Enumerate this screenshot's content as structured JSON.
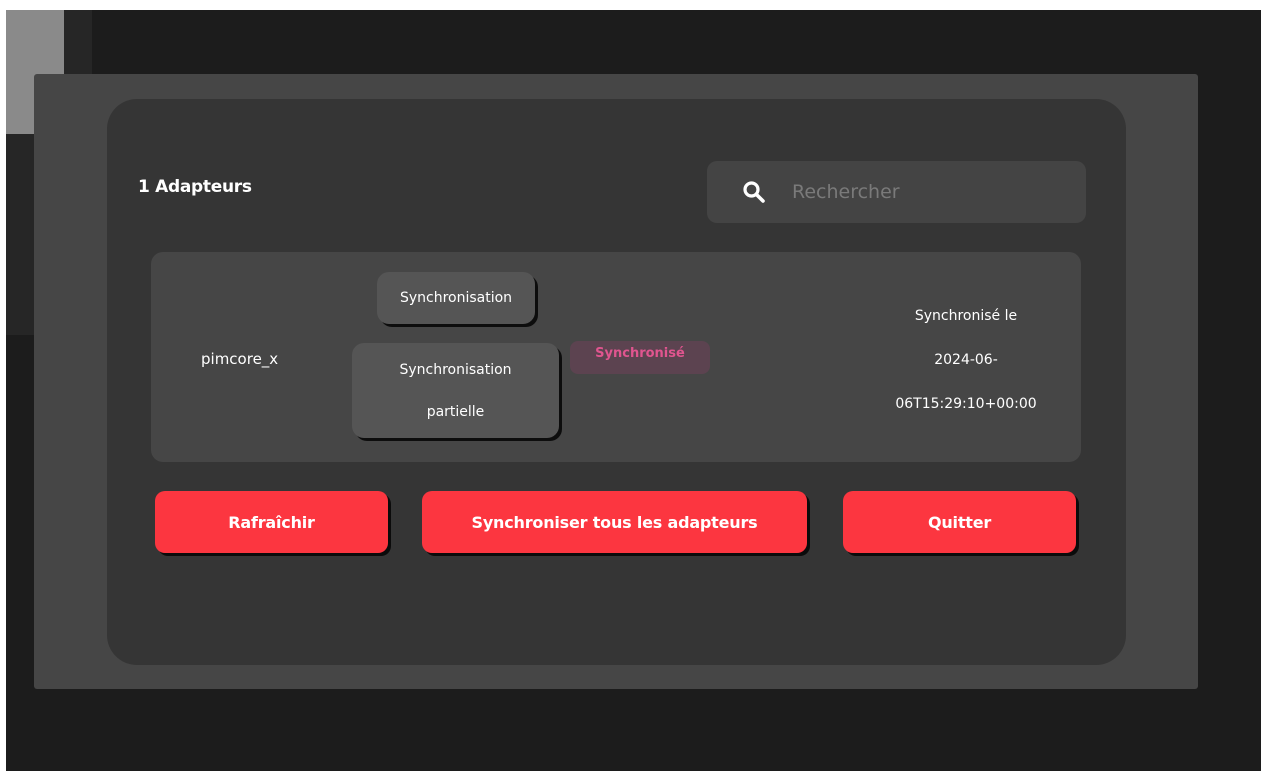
{
  "header": {
    "adapter_count_label": "1 Adapteurs"
  },
  "search": {
    "placeholder": "Rechercher",
    "value": ""
  },
  "adapters": [
    {
      "name": "pimcore_x",
      "sync_button_label": "Synchronisation",
      "partial_sync_line1": "Synchronisation",
      "partial_sync_line2": "partielle",
      "status_badge": "Synchronisé",
      "sync_date_line1": "Synchronisé le",
      "sync_date_line2": "2024-06-",
      "sync_date_line3": "06T15:29:10+00:00"
    }
  ],
  "actions": {
    "refresh_label": "Rafraîchir",
    "sync_all_label": "Synchroniser tous les adapteurs",
    "quit_label": "Quitter"
  },
  "colors": {
    "page_background": "#1c1c1c",
    "modal_overlay": "#464646",
    "modal_card": "#353535",
    "row_background": "#464646",
    "secondary_button": "#555555",
    "primary_button": "#fc3640",
    "badge_background": "#5c4350",
    "badge_text": "#e0558f"
  },
  "icons": {
    "search": "search-icon"
  }
}
